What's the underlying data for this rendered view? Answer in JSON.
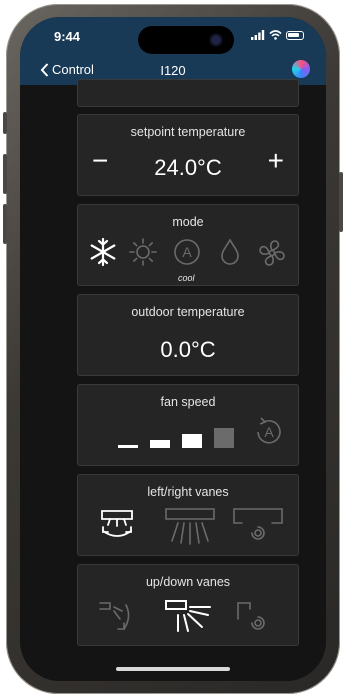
{
  "status_bar": {
    "time": "9:44"
  },
  "nav": {
    "back_label": "Control",
    "title": "I120"
  },
  "setpoint": {
    "title": "setpoint temperature",
    "value": "24.0°C",
    "minus": "−",
    "plus": "+"
  },
  "mode": {
    "title": "mode",
    "selected_label": "cool",
    "options": [
      "cool",
      "heat",
      "auto",
      "dry",
      "fan"
    ]
  },
  "outdoor": {
    "title": "outdoor temperature",
    "value": "0.0°C"
  },
  "fan_speed": {
    "title": "fan speed",
    "levels": [
      "speed-1",
      "speed-2",
      "speed-3",
      "speed-4",
      "auto"
    ]
  },
  "lr_vanes": {
    "title": "left/right vanes"
  },
  "ud_vanes": {
    "title": "up/down vanes"
  },
  "colors": {
    "header": "#183a56",
    "card": "#252525",
    "background": "#141414",
    "active": "#ffffff",
    "inactive": "#6b6b6b"
  }
}
